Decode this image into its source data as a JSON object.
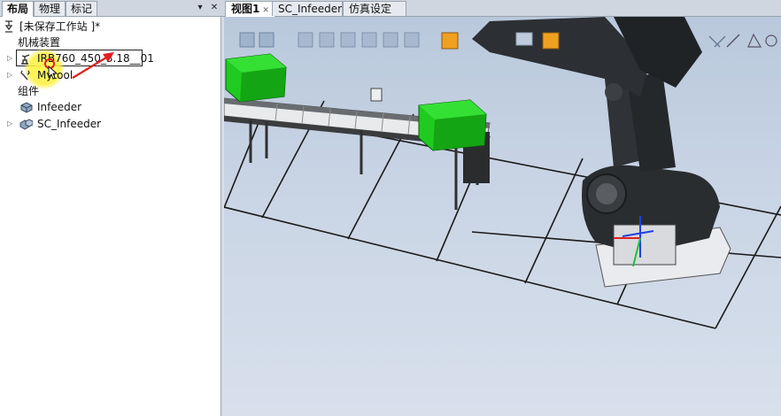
{
  "left_panel": {
    "tabs": [
      {
        "label": "布局"
      },
      {
        "label": "物理"
      },
      {
        "label": "标记"
      }
    ],
    "station_title": "[未保存工作站 ]*",
    "section_mechanisms": "机械装置",
    "robot_label": "IRB760_450_3.18__01",
    "tool_label": "Mytool",
    "section_components": "组件",
    "components": [
      {
        "label": "Infeeder"
      },
      {
        "label": "SC_Infeeder"
      }
    ]
  },
  "view_tabs": [
    {
      "label": "视图1"
    },
    {
      "label": "SC_Infeeder"
    },
    {
      "label": "仿真设定"
    }
  ],
  "icons": [
    "station-icon",
    "robot-icon",
    "tool-icon",
    "component-icon",
    "smart-component-icon"
  ],
  "colors": {
    "box": "#1fcb1f",
    "robot": "#2a2d30",
    "highlight": "#fff24a",
    "annotation": "#e02020"
  }
}
